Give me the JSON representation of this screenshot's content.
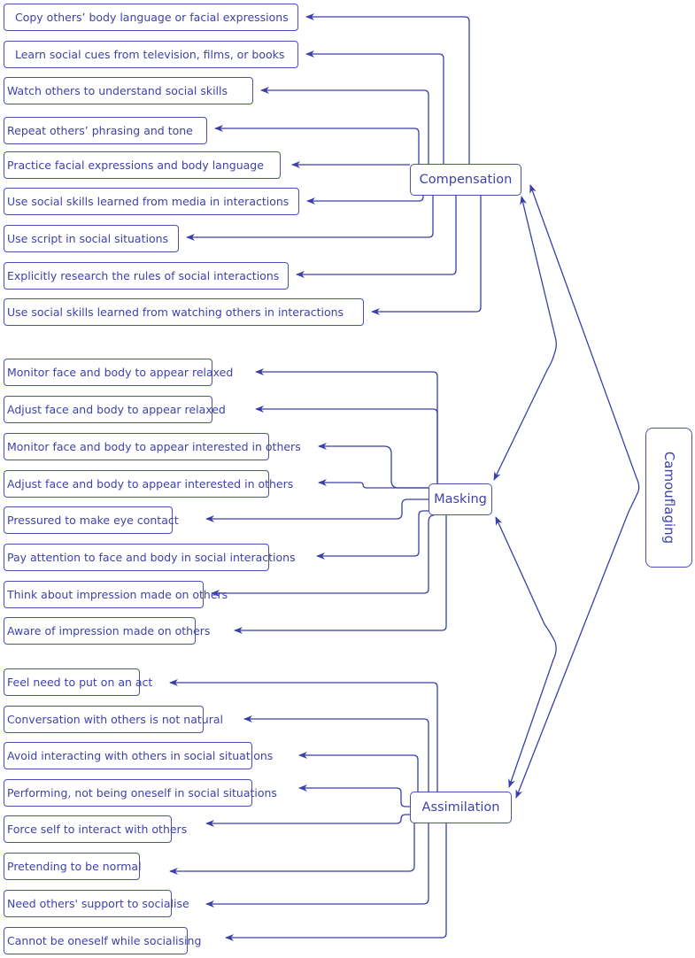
{
  "root": {
    "label": "Camouflaging"
  },
  "categories": [
    {
      "label": "Compensation",
      "items": [
        "Copy others’ body language or facial expressions",
        "Learn social cues from television, films, or books",
        "Watch others to understand social skills",
        "Repeat others’ phrasing and tone",
        "Practice facial expressions and body language",
        "Use social skills learned from media in interactions",
        "Use script in social situations",
        "Explicitly research the rules of social interactions",
        "Use social skills learned from watching others in interactions"
      ]
    },
    {
      "label": "Masking",
      "items": [
        "Monitor face and body to appear relaxed",
        "Adjust face and body to appear relaxed",
        "Monitor face and body to appear interested in others",
        "Adjust face and body to appear interested in others",
        "Pressured to make eye contact",
        "Pay attention to face and body in social interactions",
        "Think about impression made on others",
        "Aware of impression made on others"
      ]
    },
    {
      "label": "Assimilation",
      "items": [
        "Feel need to put on an act",
        "Conversation with others is not natural",
        "Avoid interacting with others in social situations",
        "Performing, not being oneself in social situations",
        "Force self to interact with others",
        "Pretending to be normal",
        "Need others' support to socialise",
        "Cannot be oneself while socialising"
      ]
    }
  ],
  "colors": {
    "line": "#3a3fa8",
    "text": "#3d42ab",
    "border": "#4b50b0"
  }
}
